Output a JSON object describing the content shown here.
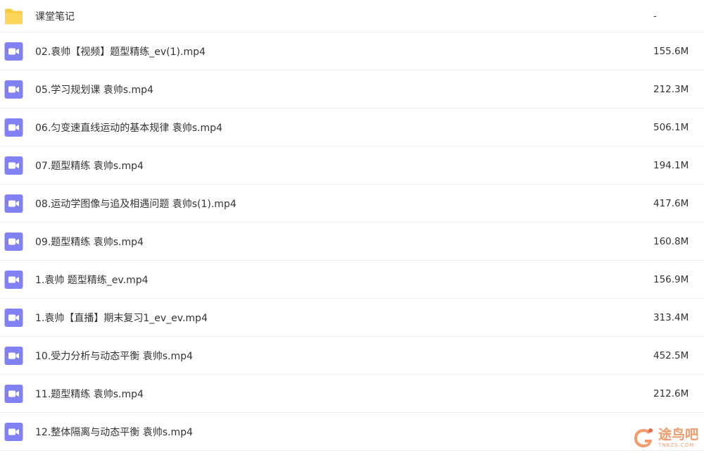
{
  "colors": {
    "folder": "#fbc93d",
    "video_icon": "#8281f3",
    "watermark": "#f3905b"
  },
  "files": [
    {
      "type": "folder",
      "icon": "folder-icon",
      "name": "课堂笔记",
      "size": "-"
    },
    {
      "type": "video",
      "icon": "video-file-icon",
      "name": "02.袁帅【视频】题型精练_ev(1).mp4",
      "size": "155.6M"
    },
    {
      "type": "video",
      "icon": "video-file-icon",
      "name": "05.学习规划课 袁帅s.mp4",
      "size": "212.3M"
    },
    {
      "type": "video",
      "icon": "video-file-icon",
      "name": "06.匀变速直线运动的基本规律 袁帅s.mp4",
      "size": "506.1M"
    },
    {
      "type": "video",
      "icon": "video-file-icon",
      "name": "07.题型精练 袁帅s.mp4",
      "size": "194.1M"
    },
    {
      "type": "video",
      "icon": "video-file-icon",
      "name": "08.运动学图像与追及相遇问题 袁帅s(1).mp4",
      "size": "417.6M"
    },
    {
      "type": "video",
      "icon": "video-file-icon",
      "name": "09.题型精练 袁帅s.mp4",
      "size": "160.8M"
    },
    {
      "type": "video",
      "icon": "video-file-icon",
      "name": "1.袁帅 题型精练_ev.mp4",
      "size": "156.9M"
    },
    {
      "type": "video",
      "icon": "video-file-icon",
      "name": "1.袁帅【直播】期末复习1_ev_ev.mp4",
      "size": "313.4M"
    },
    {
      "type": "video",
      "icon": "video-file-icon",
      "name": "10.受力分析与动态平衡 袁帅s.mp4",
      "size": "452.5M"
    },
    {
      "type": "video",
      "icon": "video-file-icon",
      "name": "11.题型精练 袁帅s.mp4",
      "size": "212.6M"
    },
    {
      "type": "video",
      "icon": "video-file-icon",
      "name": "12.整体隔离与动态平衡 袁帅s.mp4",
      "size": ""
    }
  ],
  "watermark": {
    "icon": "watermark-logo-icon",
    "text_cn": "途鸟吧",
    "text_en": "TNBZS.COM"
  }
}
